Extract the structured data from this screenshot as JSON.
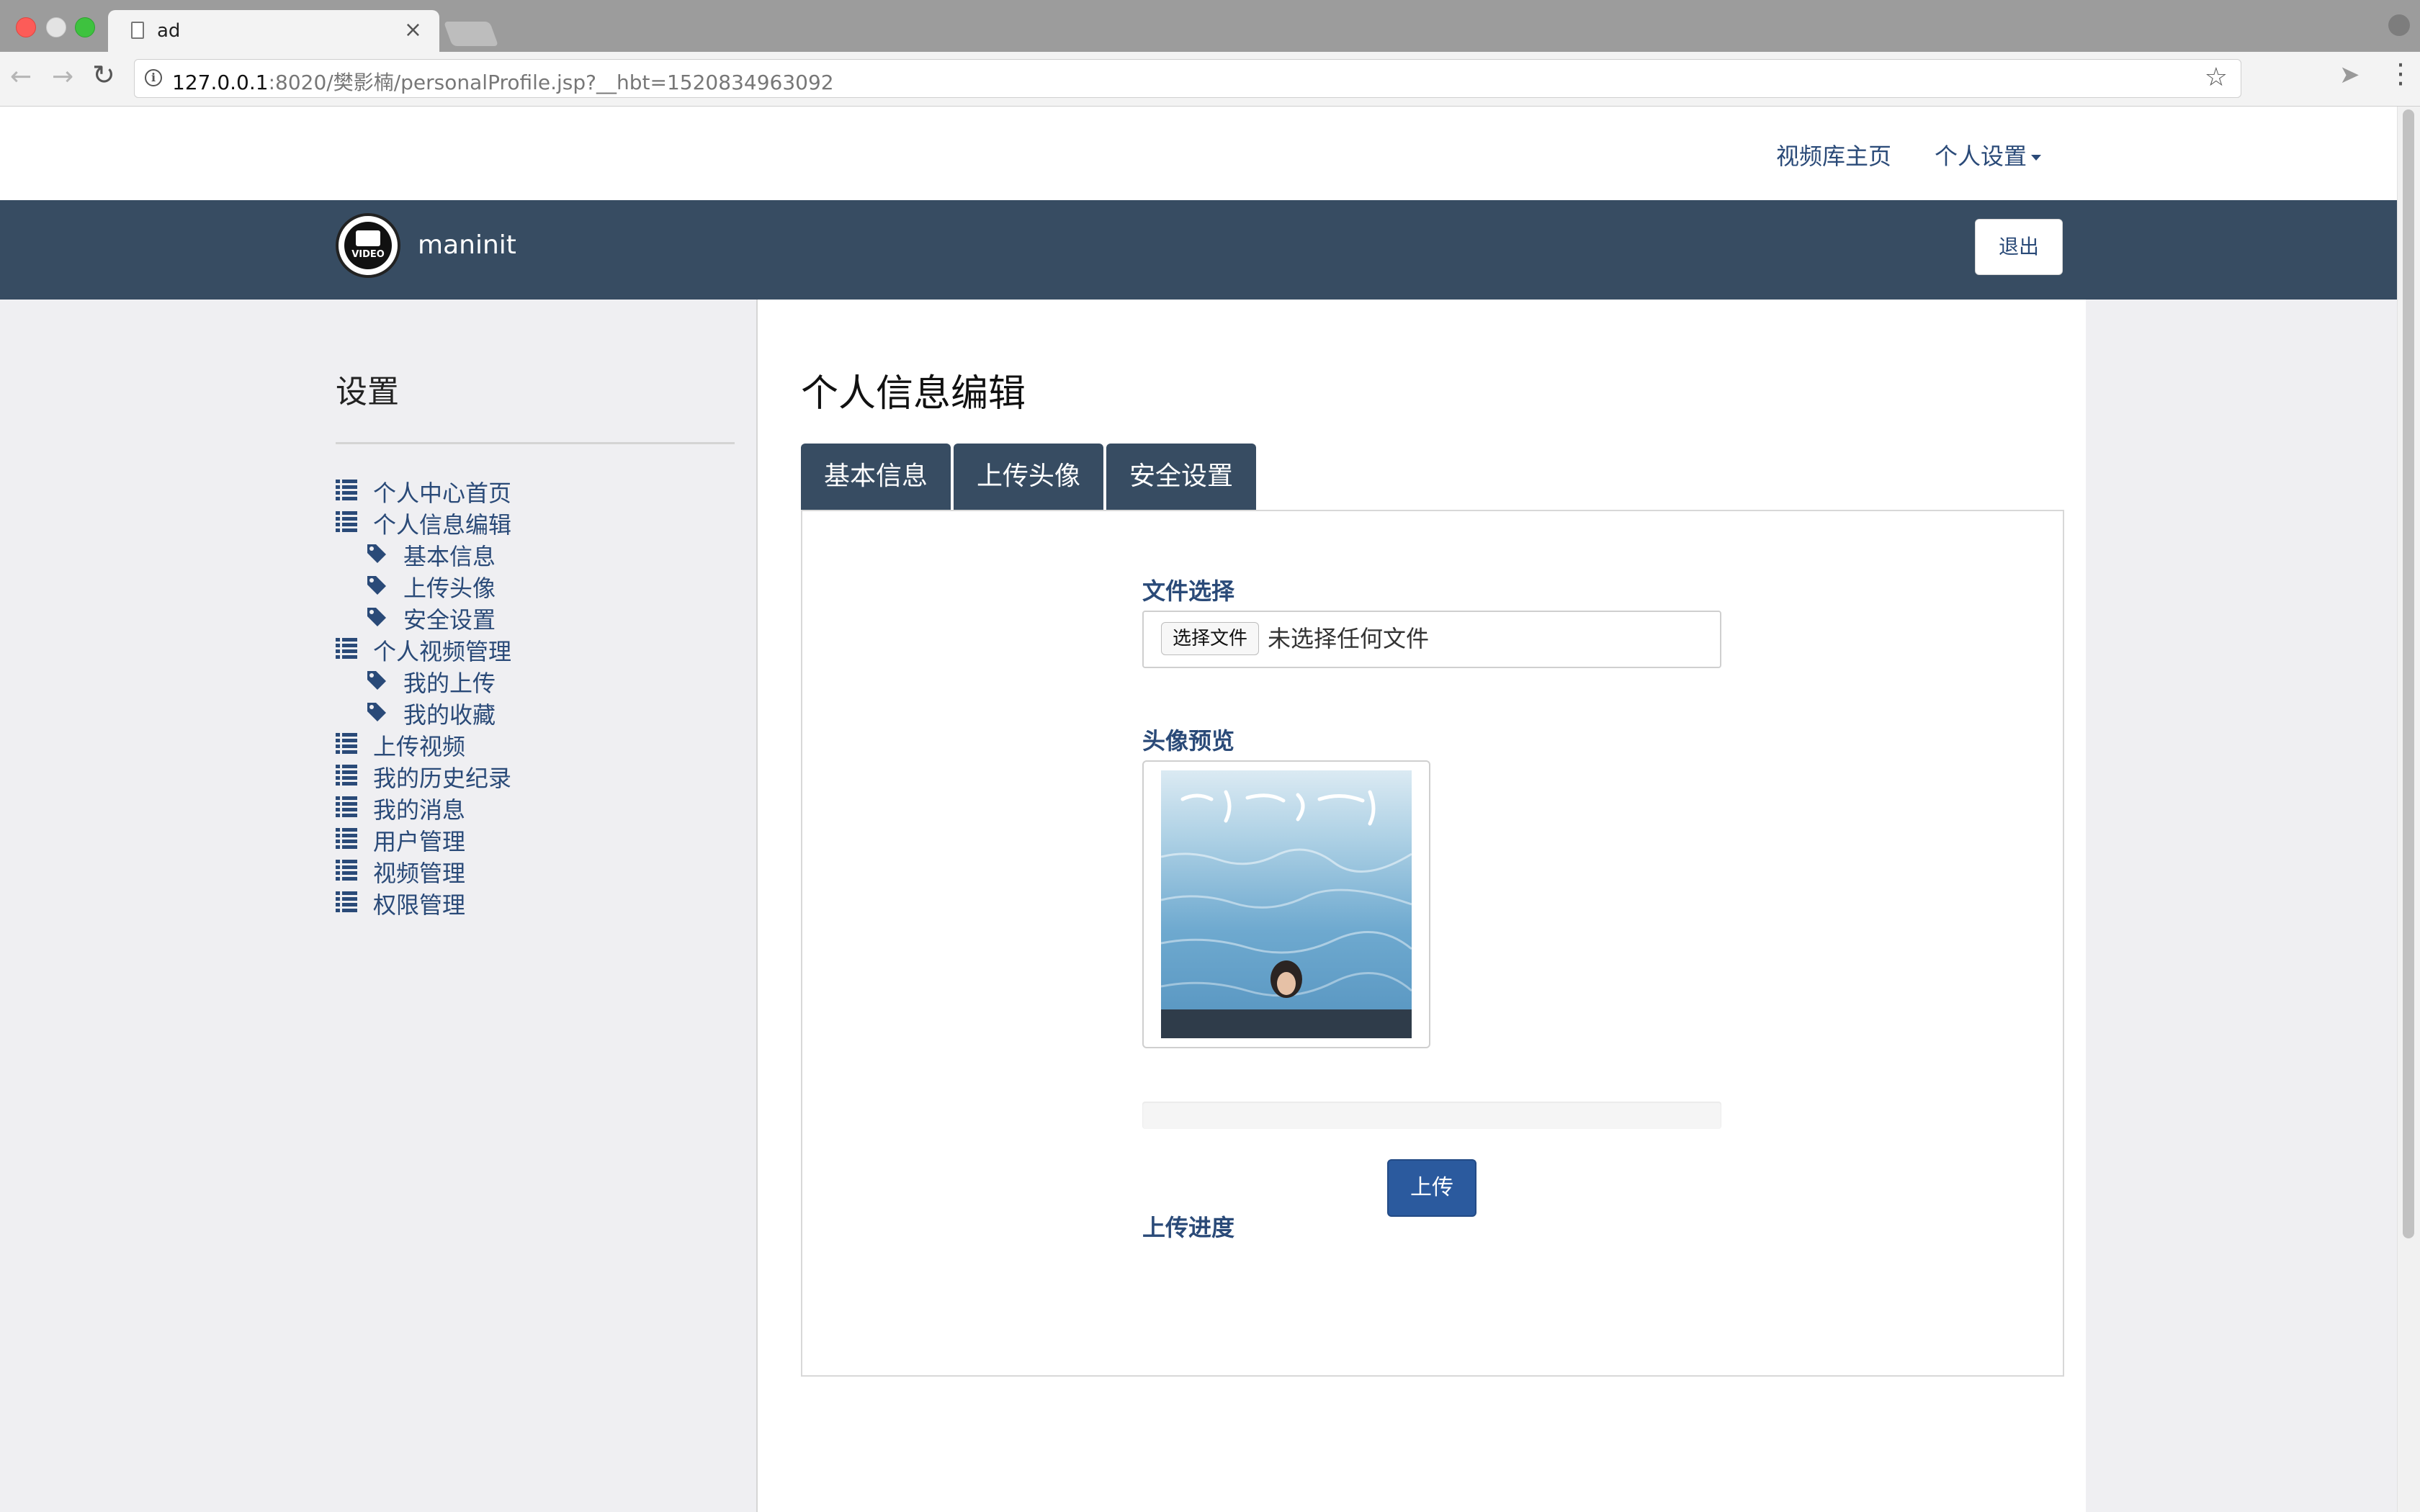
{
  "browser": {
    "tab_title": "ad",
    "tab_close": "×",
    "url_host": "127.0.0.1",
    "url_rest": ":8020/樊影楠/personalProfile.jsp?__hbt=1520834963092"
  },
  "topnav": {
    "video_home": "视频库主页",
    "personal_settings": "个人设置"
  },
  "brand": {
    "logo_text": "VIDEO",
    "name": "maninit",
    "logout": "退出"
  },
  "sidebar": {
    "title": "设置",
    "items": [
      {
        "label": "个人中心首页",
        "icon": "list-icon",
        "level": 0
      },
      {
        "label": "个人信息编辑",
        "icon": "list-icon",
        "level": 0
      },
      {
        "label": "基本信息",
        "icon": "tag-icon",
        "level": 1
      },
      {
        "label": "上传头像",
        "icon": "tag-icon",
        "level": 1
      },
      {
        "label": "安全设置",
        "icon": "tag-icon",
        "level": 1
      },
      {
        "label": "个人视频管理",
        "icon": "list-icon",
        "level": 0
      },
      {
        "label": "我的上传",
        "icon": "tag-icon",
        "level": 1
      },
      {
        "label": "我的收藏",
        "icon": "tag-icon",
        "level": 1
      },
      {
        "label": "上传视频",
        "icon": "list-icon",
        "level": 0
      },
      {
        "label": "我的历史纪录",
        "icon": "list-icon",
        "level": 0
      },
      {
        "label": "我的消息",
        "icon": "list-icon",
        "level": 0
      },
      {
        "label": "用户管理",
        "icon": "list-icon",
        "level": 0
      },
      {
        "label": "视频管理",
        "icon": "list-icon",
        "level": 0
      },
      {
        "label": "权限管理",
        "icon": "list-icon",
        "level": 0
      }
    ]
  },
  "main": {
    "title": "个人信息编辑",
    "tabs": [
      "基本信息",
      "上传头像",
      "安全设置"
    ],
    "file_label": "文件选择",
    "file_button": "选择文件",
    "file_status": "未选择任何文件",
    "preview_label": "头像预览",
    "progress_label": "上传进度",
    "progress_value": 0,
    "upload_button": "上传"
  },
  "colors": {
    "brand_bar": "#374c62",
    "link": "#2a4a78",
    "primary_button": "#2b5a9e"
  }
}
